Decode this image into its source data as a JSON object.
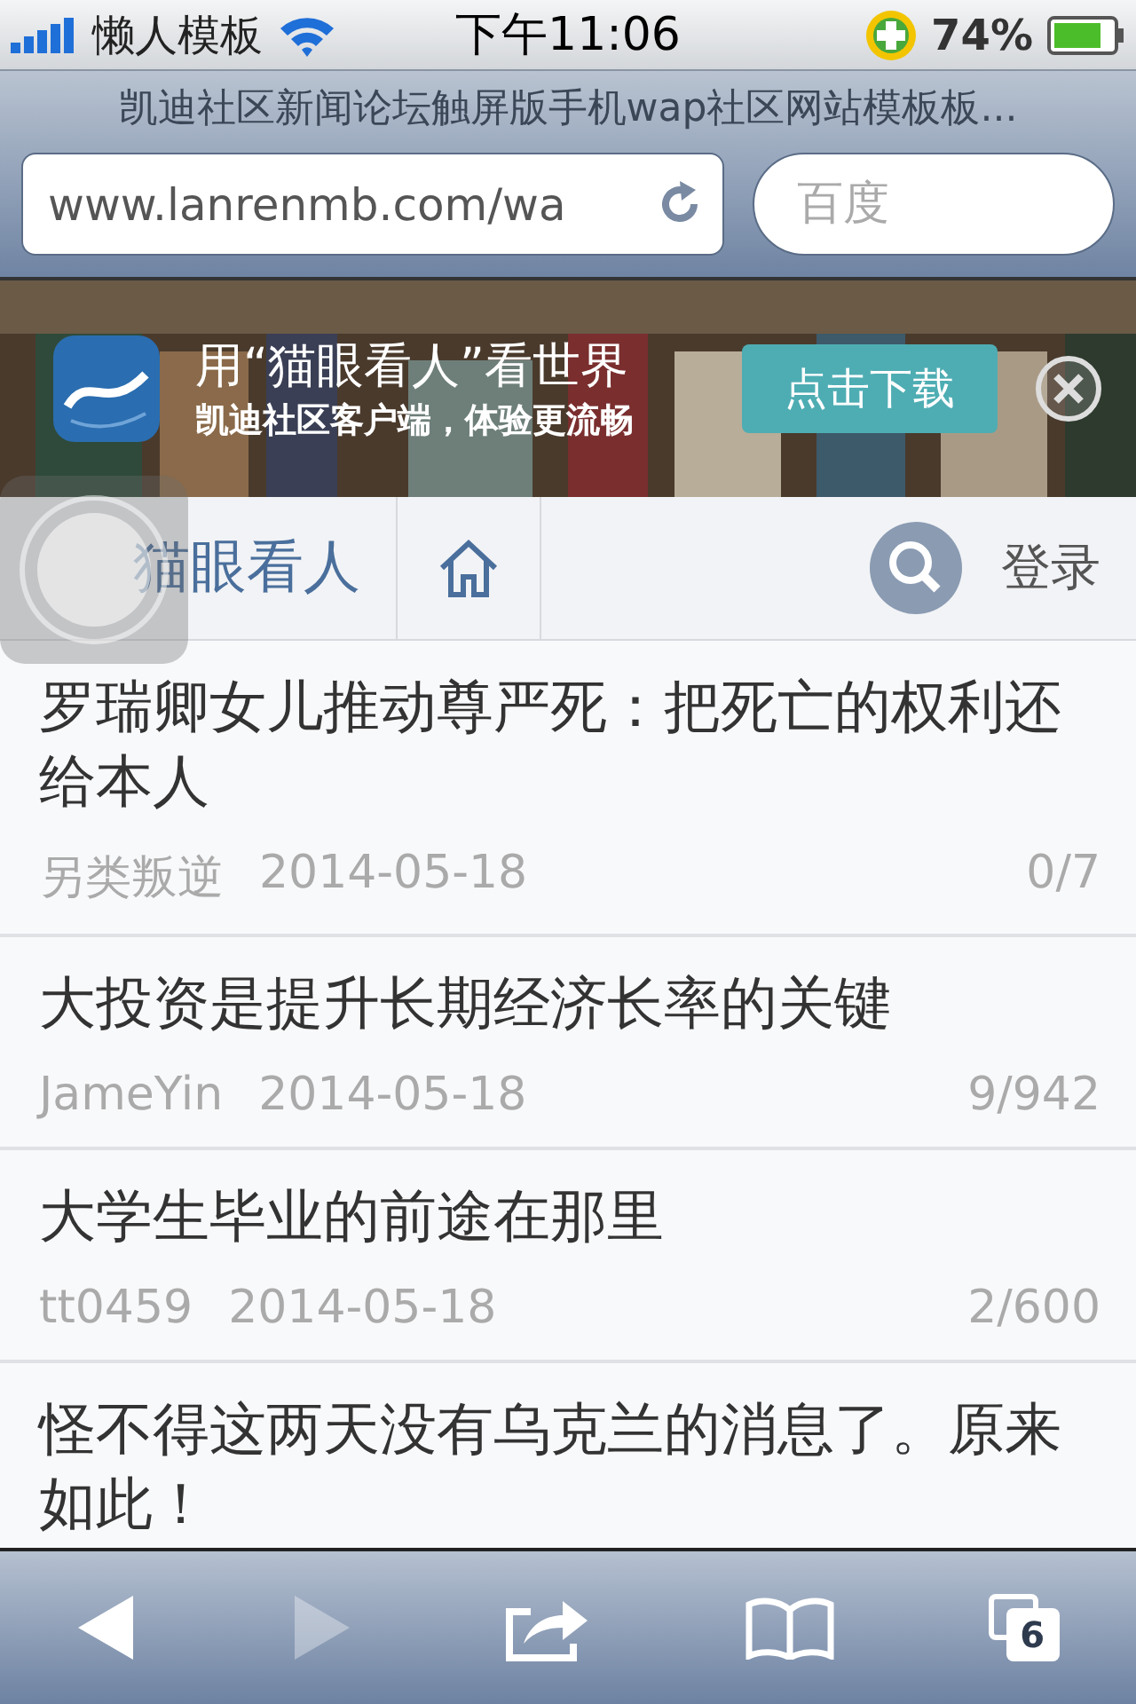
{
  "status_bar": {
    "carrier": "懒人模板",
    "time": "下午11:06",
    "battery": "74%"
  },
  "browser": {
    "page_title": "凯迪社区新闻论坛触屏版手机wap社区网站模板板...",
    "url": "www.lanrenmb.com/wa",
    "search_placeholder": "百度"
  },
  "banner": {
    "title": "用“猫眼看人”看世界",
    "subtitle": "凯迪社区客户端，体验更流畅",
    "button": "点击下载"
  },
  "nav": {
    "title": "猫眼看人",
    "login": "登录"
  },
  "posts": [
    {
      "title": "罗瑞卿女儿推动尊严死：把死亡的权利还给本人",
      "author": "另类叛逆",
      "date": "2014-05-18",
      "stats": "0/7"
    },
    {
      "title": "大投资是提升长期经济长率的关键",
      "author": "JameYin",
      "date": "2014-05-18",
      "stats": "9/942"
    },
    {
      "title": "大学生毕业的前途在那里",
      "author": "tt0459",
      "date": "2014-05-18",
      "stats": "2/600"
    },
    {
      "title": "怪不得这两天没有乌克兰的消息了。原来如此！"
    }
  ],
  "toolbar": [
    {
      "kind": "back",
      "disabled": false
    },
    {
      "kind": "forward",
      "disabled": true
    },
    {
      "kind": "share",
      "disabled": false
    },
    {
      "kind": "bookmarks",
      "disabled": false
    },
    {
      "kind": "tabs",
      "disabled": false,
      "count": "6"
    }
  ]
}
